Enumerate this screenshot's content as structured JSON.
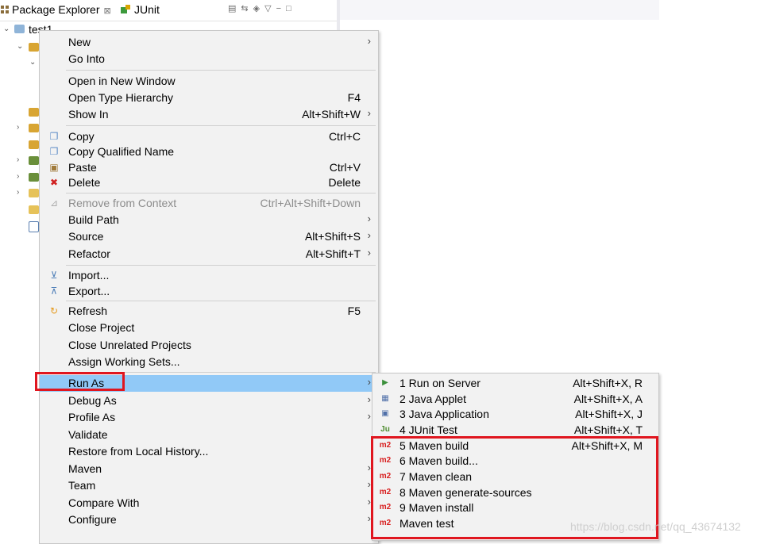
{
  "tabs": [
    {
      "label": "Package Explorer",
      "close": "⊠"
    },
    {
      "label": "JUnit"
    }
  ],
  "tree": {
    "project": "test1"
  },
  "menu": {
    "items": [
      {
        "label": "New",
        "shortcut": "",
        "submenu": true
      },
      {
        "label": "Go Into",
        "shortcut": ""
      },
      {
        "label": "Open in New Window",
        "shortcut": ""
      },
      {
        "label": "Open Type Hierarchy",
        "shortcut": "F4"
      },
      {
        "label": "Show In",
        "shortcut": "Alt+Shift+W",
        "submenu": true
      },
      {
        "label": "Copy",
        "shortcut": "Ctrl+C",
        "icon": "copy-icon"
      },
      {
        "label": "Copy Qualified Name",
        "shortcut": "",
        "icon": "copy-qualified-icon"
      },
      {
        "label": "Paste",
        "shortcut": "Ctrl+V",
        "icon": "paste-icon"
      },
      {
        "label": "Delete",
        "shortcut": "Delete",
        "icon": "delete-icon"
      },
      {
        "label": "Remove from Context",
        "shortcut": "Ctrl+Alt+Shift+Down",
        "disabled": true,
        "icon": "remove-context-icon"
      },
      {
        "label": "Build Path",
        "shortcut": "",
        "submenu": true
      },
      {
        "label": "Source",
        "shortcut": "Alt+Shift+S",
        "submenu": true
      },
      {
        "label": "Refactor",
        "shortcut": "Alt+Shift+T",
        "submenu": true
      },
      {
        "label": "Import...",
        "shortcut": "",
        "icon": "import-icon"
      },
      {
        "label": "Export...",
        "shortcut": "",
        "icon": "export-icon"
      },
      {
        "label": "Refresh",
        "shortcut": "F5",
        "icon": "refresh-icon"
      },
      {
        "label": "Close Project",
        "shortcut": ""
      },
      {
        "label": "Close Unrelated Projects",
        "shortcut": ""
      },
      {
        "label": "Assign Working Sets...",
        "shortcut": ""
      },
      {
        "label": "Run As",
        "shortcut": "",
        "submenu": true,
        "highlighted": true
      },
      {
        "label": "Debug As",
        "shortcut": "",
        "submenu": true
      },
      {
        "label": "Profile As",
        "shortcut": "",
        "submenu": true
      },
      {
        "label": "Validate",
        "shortcut": ""
      },
      {
        "label": "Restore from Local History...",
        "shortcut": ""
      },
      {
        "label": "Maven",
        "shortcut": "",
        "submenu": true
      },
      {
        "label": "Team",
        "shortcut": "",
        "submenu": true
      },
      {
        "label": "Compare With",
        "shortcut": "",
        "submenu": true
      },
      {
        "label": "Configure",
        "shortcut": "",
        "submenu": true
      }
    ]
  },
  "run_as_submenu": {
    "items": [
      {
        "label": "1 Run on Server",
        "shortcut": "Alt+Shift+X, R",
        "icon": "server-icon"
      },
      {
        "label": "2 Java Applet",
        "shortcut": "Alt+Shift+X, A",
        "icon": "applet-icon"
      },
      {
        "label": "3 Java Application",
        "shortcut": "Alt+Shift+X, J",
        "icon": "java-app-icon"
      },
      {
        "label": "4 JUnit Test",
        "shortcut": "Alt+Shift+X, T",
        "icon": "junit-icon",
        "icon_text": "Ju"
      },
      {
        "label": "5 Maven build",
        "shortcut": "Alt+Shift+X, M",
        "icon": "maven-icon",
        "icon_text": "m2"
      },
      {
        "label": "6 Maven build...",
        "shortcut": "",
        "icon": "maven-icon",
        "icon_text": "m2"
      },
      {
        "label": "7 Maven clean",
        "shortcut": "",
        "icon": "maven-icon",
        "icon_text": "m2"
      },
      {
        "label": "8 Maven generate-sources",
        "shortcut": "",
        "icon": "maven-icon",
        "icon_text": "m2"
      },
      {
        "label": "9 Maven install",
        "shortcut": "",
        "icon": "maven-icon",
        "icon_text": "m2"
      },
      {
        "label": "Maven test",
        "shortcut": "",
        "icon": "maven-icon",
        "icon_text": "m2"
      }
    ]
  },
  "watermark": "https://blog.csdn.net/qq_43674132",
  "colors": {
    "highlight": "#91c9f7",
    "annotation": "#e0161f",
    "maven": "#d81f1f"
  }
}
